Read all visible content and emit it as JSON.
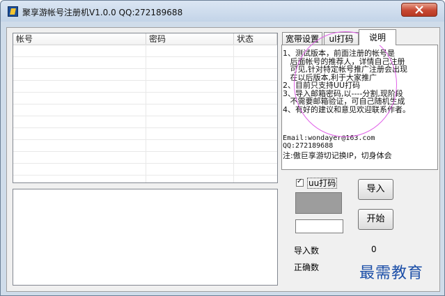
{
  "window": {
    "title": "聚享游帐号注册机V1.0.0 QQ:272189688"
  },
  "table": {
    "columns": [
      "帐号",
      "密码",
      "状态"
    ],
    "rows": []
  },
  "tabs": [
    {
      "label": "宽带设置",
      "active": false
    },
    {
      "label": "ul打码",
      "active": false
    },
    {
      "label": "说明",
      "active": true
    }
  ],
  "notes": {
    "text": "1、测试版本，前面注册的帐号是\n   后面帐号的推荐人，详情自己注册\n   可见,针对特定帐号推广注册会出现\n   在以后版本,利于大家推广\n2、目前只支持UU打码\n3、导入邮箱密码,以----分割,现阶段\n   不需要邮箱验证，可自己随机生成\n4、有好的建议和意见欢迎联系作者。",
    "email": "Email:wondayer@163.com\nQQ:272189688",
    "ip_note": "注:傲巨享游切记换IP，切身体会"
  },
  "controls": {
    "checkbox_label": "uu打码",
    "checkbox_checked": true,
    "import_button": "导入",
    "start_button": "开始",
    "color_swatch": "#9d9d9d"
  },
  "stats": {
    "import_count_label": "导入数",
    "import_count_value": "0",
    "correct_count_label": "正确数",
    "correct_count_value": ""
  },
  "watermark": {
    "text": "最需教育"
  },
  "colors": {
    "highlight_circle": "#e060e8",
    "watermark": "#1c4fa8",
    "close_button": "#c74832"
  }
}
